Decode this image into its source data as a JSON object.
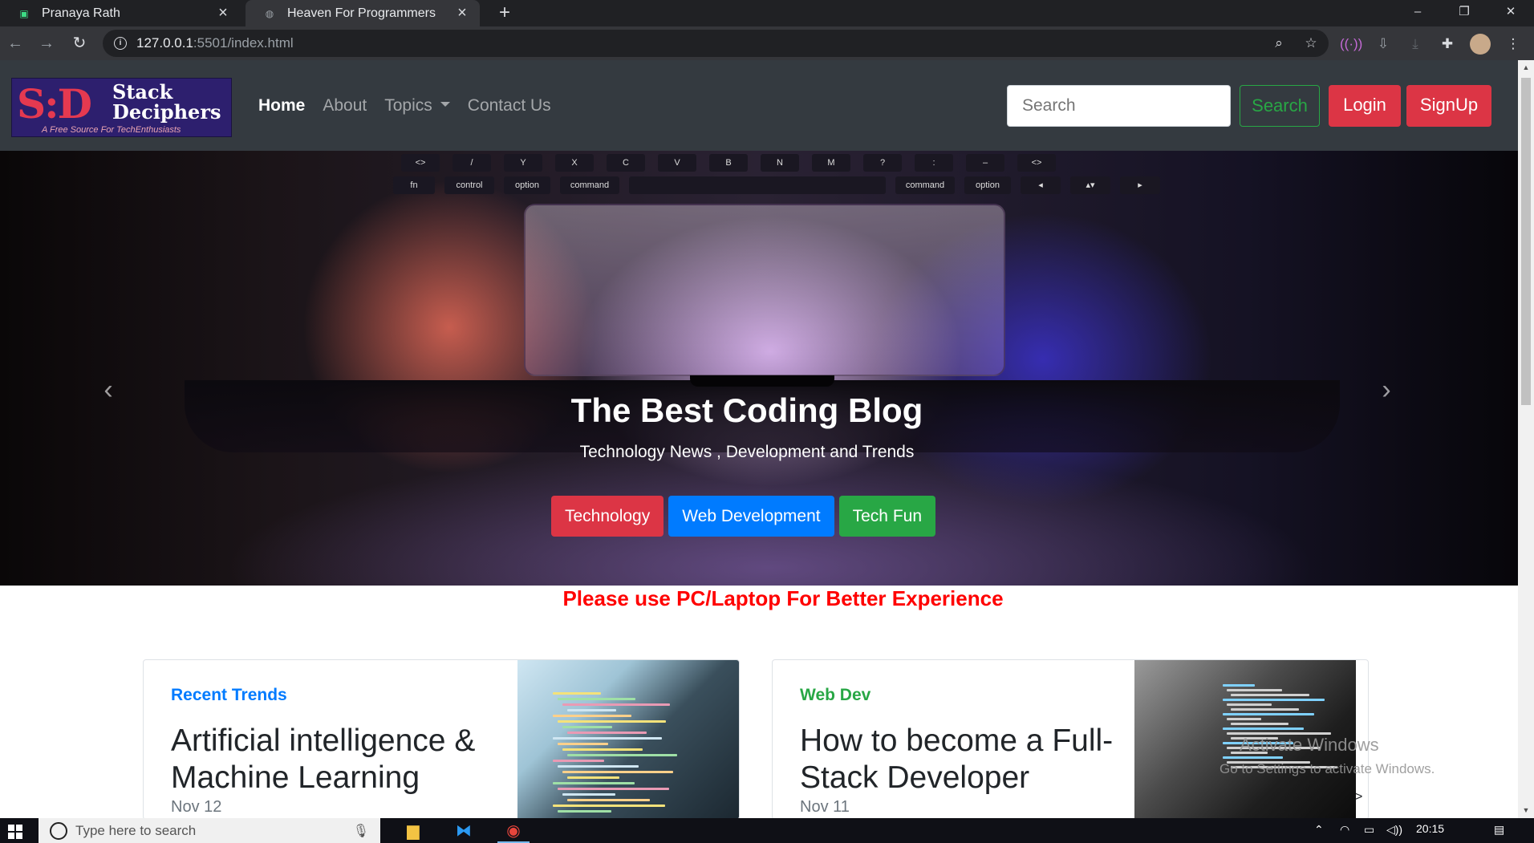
{
  "browser": {
    "tabs": [
      {
        "title": "Pranaya Rath",
        "active": false
      },
      {
        "title": "Heaven For Programmers",
        "active": true
      }
    ],
    "new_tab": "+",
    "url_host": "127.0.0.1",
    "url_rest": ":5501/index.html",
    "window_controls": {
      "minimize": "–",
      "restore": "❐",
      "close": "✕"
    }
  },
  "navbar": {
    "logo": {
      "mark": "S:D",
      "name_line1": "Stack",
      "name_line2": "Deciphers",
      "tagline": "A Free Source For TechEnthusiasts"
    },
    "links": [
      {
        "label": "Home",
        "active": true
      },
      {
        "label": "About",
        "active": false
      },
      {
        "label": "Topics",
        "active": false,
        "dropdown": true
      },
      {
        "label": "Contact Us",
        "active": false
      }
    ],
    "search_placeholder": "Search",
    "search_button": "Search",
    "login_button": "Login",
    "signup_button": "SignUp"
  },
  "hero": {
    "title": "The Best Coding Blog",
    "subtitle": "Technology News , Development and Trends",
    "buttons": [
      {
        "label": "Technology",
        "color": "#dc3545"
      },
      {
        "label": "Web Development",
        "color": "#007bff"
      },
      {
        "label": "Tech Fun",
        "color": "#28a745"
      }
    ],
    "keys_row1": [
      "<>",
      "/",
      "Y",
      "X",
      "C",
      "V",
      "B",
      "N",
      "M",
      "?",
      ":",
      "–",
      "<>"
    ],
    "keys_row2": [
      "fn",
      "control",
      "option",
      "command",
      "",
      "command",
      "option",
      "◂",
      "▴▾",
      "▸"
    ]
  },
  "notice": "Please use PC/Laptop For Better Experience",
  "cards": [
    {
      "category": "Recent Trends",
      "title": "Artificial intelligence & Machine Learning",
      "date": "Nov 12"
    },
    {
      "category": "Web Dev",
      "title": "How to become a Full-Stack Developer",
      "date": "Nov 11"
    }
  ],
  "watermark": {
    "line1": "Activate Windows",
    "line2": "Go to Settings to activate Windows."
  },
  "card_next": ">",
  "taskbar": {
    "search_placeholder": "Type here to search",
    "time": "20:15"
  },
  "colors": {
    "navbar_bg": "#343a40",
    "danger": "#dc3545",
    "primary": "#007bff",
    "success": "#28a745",
    "notice": "#ff0000"
  }
}
